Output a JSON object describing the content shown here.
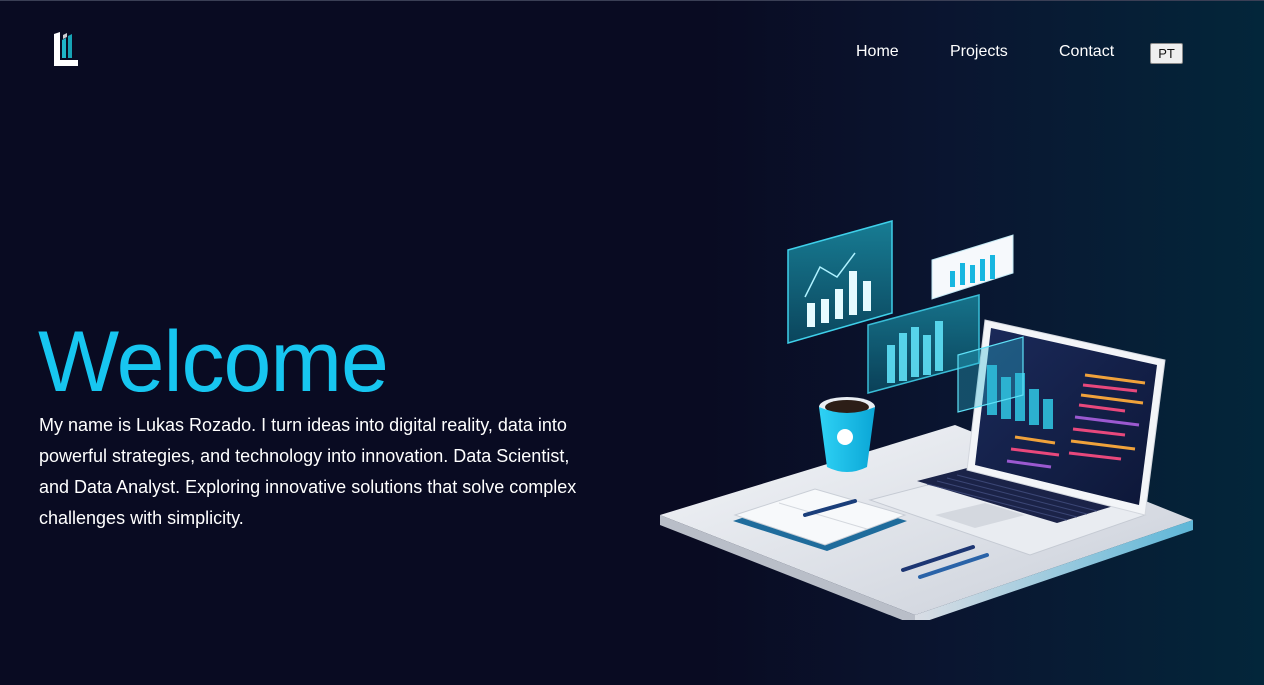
{
  "header": {
    "logo_icon": "building-logo-icon",
    "nav": [
      {
        "label": "Home"
      },
      {
        "label": "Projects"
      },
      {
        "label": "Contact"
      }
    ],
    "language_button": "PT"
  },
  "hero": {
    "title": "Welcome",
    "intro_lines": [
      "My name is Lukas Rozado. I turn ideas into digital reality, data into",
      "powerful strategies, and technology into innovation. Data Scientist,",
      "and Data Analyst. Exploring innovative solutions that solve complex",
      "challenges with simplicity."
    ],
    "illustration_icon": "workspace-laptop-illustration"
  },
  "colors": {
    "background": "#090b22",
    "accent": "#17c6f0",
    "text": "#ffffff"
  }
}
